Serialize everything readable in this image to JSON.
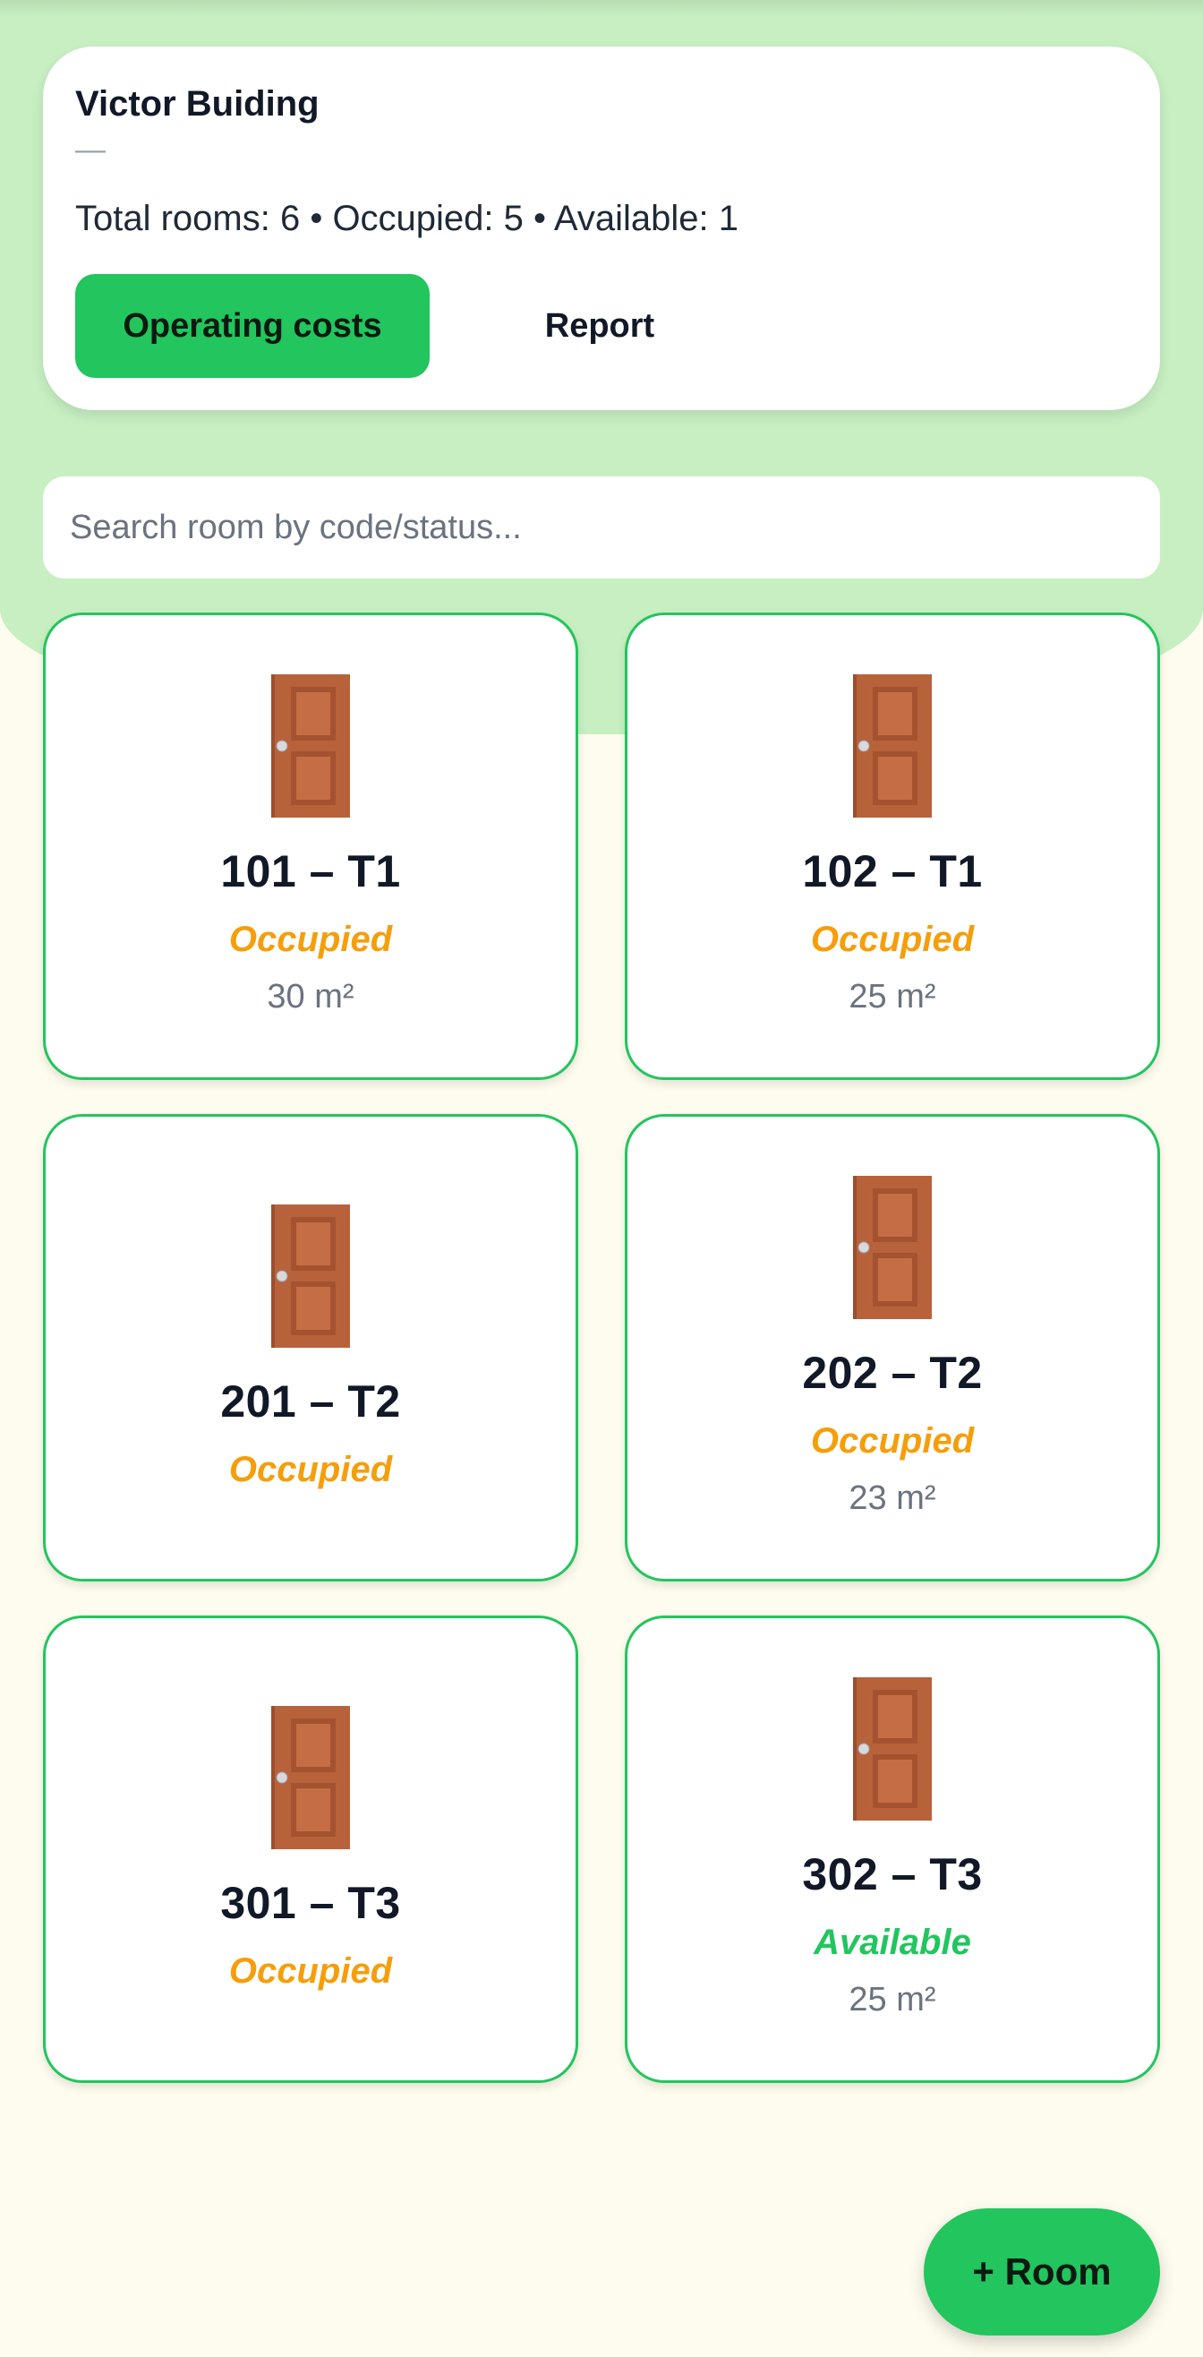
{
  "building": {
    "name": "Victor Buiding",
    "subtitle": "—",
    "summary": "Total rooms: 6 • Occupied: 5 • Available: 1",
    "operating_costs_label": "Operating costs",
    "report_label": "Report"
  },
  "search": {
    "placeholder": "Search room by code/status...",
    "value": ""
  },
  "colors": {
    "accent": "#22c55e",
    "occupied": "#f59e0b",
    "available": "#22c55e",
    "background": "#fefcee",
    "header_green": "#c7efc2"
  },
  "rooms": [
    {
      "code": "101 – T1",
      "status": "Occupied",
      "area": "30 m²",
      "icon": "door-icon"
    },
    {
      "code": "102 – T1",
      "status": "Occupied",
      "area": "25 m²",
      "icon": "door-icon"
    },
    {
      "code": "201 – T2",
      "status": "Occupied",
      "area": "",
      "icon": "door-icon"
    },
    {
      "code": "202 – T2",
      "status": "Occupied",
      "area": "23 m²",
      "icon": "door-icon"
    },
    {
      "code": "301 – T3",
      "status": "Occupied",
      "area": "",
      "icon": "door-icon"
    },
    {
      "code": "302 – T3",
      "status": "Available",
      "area": "25 m²",
      "icon": "door-icon"
    }
  ],
  "fab": {
    "label": "+ Room"
  }
}
